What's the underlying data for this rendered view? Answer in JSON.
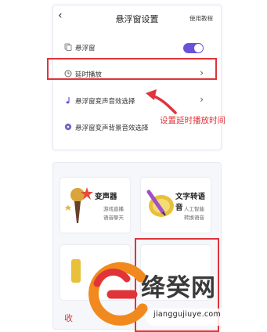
{
  "header": {
    "back_glyph": "‹",
    "title": "悬浮窗设置",
    "help": "使用教程"
  },
  "settings": [
    {
      "label": "悬浮窗",
      "icon": "window-icon",
      "control": "toggle",
      "on": true
    },
    {
      "label": "延时播放",
      "icon": "clock-icon",
      "control": "chevron"
    },
    {
      "label": "悬浮窗变声音效选择",
      "icon": "music-note-icon",
      "control": "chevron"
    },
    {
      "label": "悬浮窗变声背景音效选择",
      "icon": "disc-icon",
      "control": "none"
    }
  ],
  "chevron_glyph": "›",
  "annotation": "设置延时播放时间",
  "tools": [
    {
      "name": "变声器",
      "desc1": "游戏直播",
      "desc2": "语音聊天"
    },
    {
      "name": "文字转语音",
      "desc1": "人工智能",
      "desc2": "转换语音"
    }
  ],
  "bottom_partial": "收",
  "watermark": {
    "text": "绛癸网",
    "url": "jianggujiuye.com"
  },
  "colors": {
    "accent": "#6b52d8",
    "annotation_red": "#e0343a"
  }
}
